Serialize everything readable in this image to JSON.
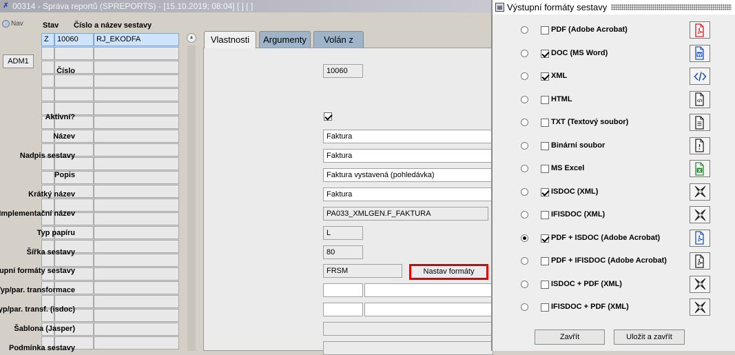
{
  "main_window": {
    "title": "00314 - Správa reportů (SPREPORTS) - [15.10.2019; 08:04]  [ ]  [ ]",
    "nav_label": "Nav",
    "adm_button": "ADM1",
    "grid": {
      "headers": [
        "Stav",
        "Číslo a název sestavy"
      ],
      "selected_row": {
        "stav": "Z",
        "cislo": "10060",
        "nazev": "RJ_EKODFA"
      }
    },
    "tabs": [
      "Vlastnosti",
      "Argumenty",
      "Volán z"
    ],
    "form": {
      "cislo_label": "Číslo",
      "cislo_value": "10060",
      "aktivni_label": "Aktivní?",
      "nazev_label": "Název",
      "nazev_value": "Faktura",
      "nadpis_label": "Nadpis sestavy",
      "nadpis_value": "Faktura",
      "popis_label": "Popis",
      "popis_value": "Faktura vystavená (pohledávka)",
      "kratky_label": "Krátký název",
      "kratky_value": "Faktura",
      "impl_label": "Implementační název",
      "impl_value": "PA033_XMLGEN.F_FAKTURA",
      "typ_papiru_label": "Typ papíru",
      "typ_papiru_value": "L",
      "sirka_label": "Šířka sestavy",
      "sirka_value": "80",
      "vystupni_label": "Výstupní formáty sestavy",
      "vystupni_value": "FRSM",
      "nastav_button": "Nastav formáty",
      "transf_label": "Typ/par. transformace",
      "transf_isdoc_label": "Typ/par. transf. (isdoc)",
      "sablona_label": "Šablona (Jasper)",
      "podminka_label": "Podmínka sestavy"
    }
  },
  "dialog": {
    "title": "Výstupní formáty sestavy",
    "formats": [
      {
        "label": "PDF (Adobe Acrobat)",
        "checked": false,
        "default": false,
        "icon": "pdf-icon"
      },
      {
        "label": "DOC (MS Word)",
        "checked": true,
        "default": false,
        "icon": "word-icon"
      },
      {
        "label": "XML",
        "checked": true,
        "default": false,
        "icon": "xml-code-icon"
      },
      {
        "label": "HTML",
        "checked": false,
        "default": false,
        "icon": "html-file-icon"
      },
      {
        "label": "TXT (Textový soubor)",
        "checked": false,
        "default": false,
        "icon": "text-file-icon"
      },
      {
        "label": "Binární soubor",
        "checked": false,
        "default": false,
        "icon": "binary-file-icon"
      },
      {
        "label": "MS Excel",
        "checked": false,
        "default": false,
        "icon": "excel-icon"
      },
      {
        "label": "ISDOC (XML)",
        "checked": true,
        "default": false,
        "icon": "isdoc-icon"
      },
      {
        "label": "IFISDOC (XML)",
        "checked": false,
        "default": false,
        "icon": "isdoc-icon"
      },
      {
        "label": "PDF + ISDOC (Adobe Acrobat)",
        "checked": true,
        "default": true,
        "icon": "pdf-blue-icon"
      },
      {
        "label": "PDF + IFISDOC (Adobe Acrobat)",
        "checked": false,
        "default": false,
        "icon": "pdf-black-icon"
      },
      {
        "label": "ISDOC + PDF (XML)",
        "checked": false,
        "default": false,
        "icon": "isdoc-icon"
      },
      {
        "label": "IFISDOC + PDF (XML)",
        "checked": false,
        "default": false,
        "icon": "isdoc-icon"
      }
    ],
    "close_button": "Zavřít",
    "save_close_button": "Uložit a zavřít"
  }
}
